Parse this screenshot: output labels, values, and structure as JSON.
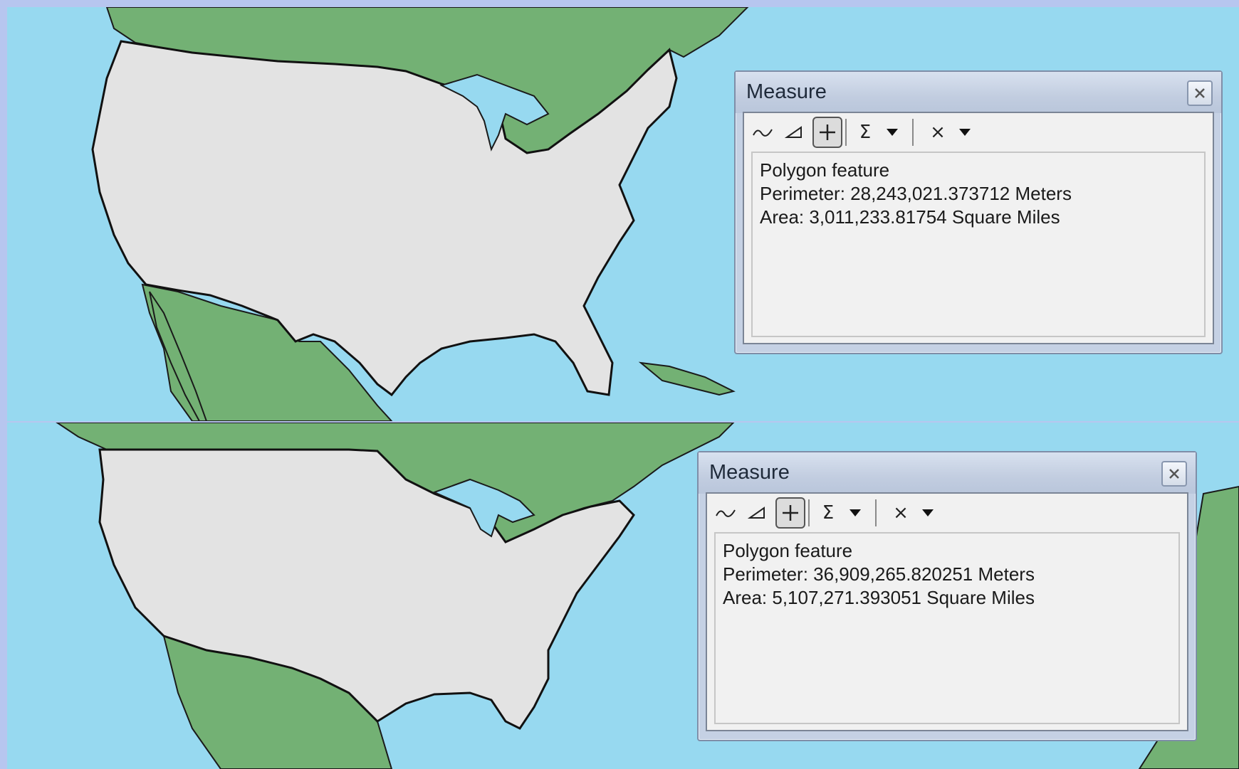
{
  "colors": {
    "ocean": "#97d9f0",
    "land_other": "#73b174",
    "land_usa": "#e3e3e3",
    "frame": "#b7c6ef"
  },
  "map_top": {
    "measure": {
      "title": "Measure",
      "tools": [
        "measure-line-icon",
        "measure-area-icon",
        "measure-feature-icon",
        "sum-icon",
        "dropdown-icon",
        "clear-icon",
        "dropdown-icon"
      ],
      "tool_labels": {
        "sum": "Σ",
        "clear": "×"
      },
      "result": {
        "type": "Polygon feature",
        "perimeter": "Perimeter: 28,243,021.373712 Meters",
        "area": "Area: 3,011,233.81754 Square Miles"
      }
    }
  },
  "map_bottom": {
    "measure": {
      "title": "Measure",
      "tools": [
        "measure-line-icon",
        "measure-area-icon",
        "measure-feature-icon",
        "sum-icon",
        "dropdown-icon",
        "clear-icon",
        "dropdown-icon"
      ],
      "tool_labels": {
        "sum": "Σ",
        "clear": "×"
      },
      "result": {
        "type": "Polygon feature",
        "perimeter": "Perimeter: 36,909,265.820251 Meters",
        "area": "Area: 5,107,271.393051 Square Miles"
      }
    }
  }
}
